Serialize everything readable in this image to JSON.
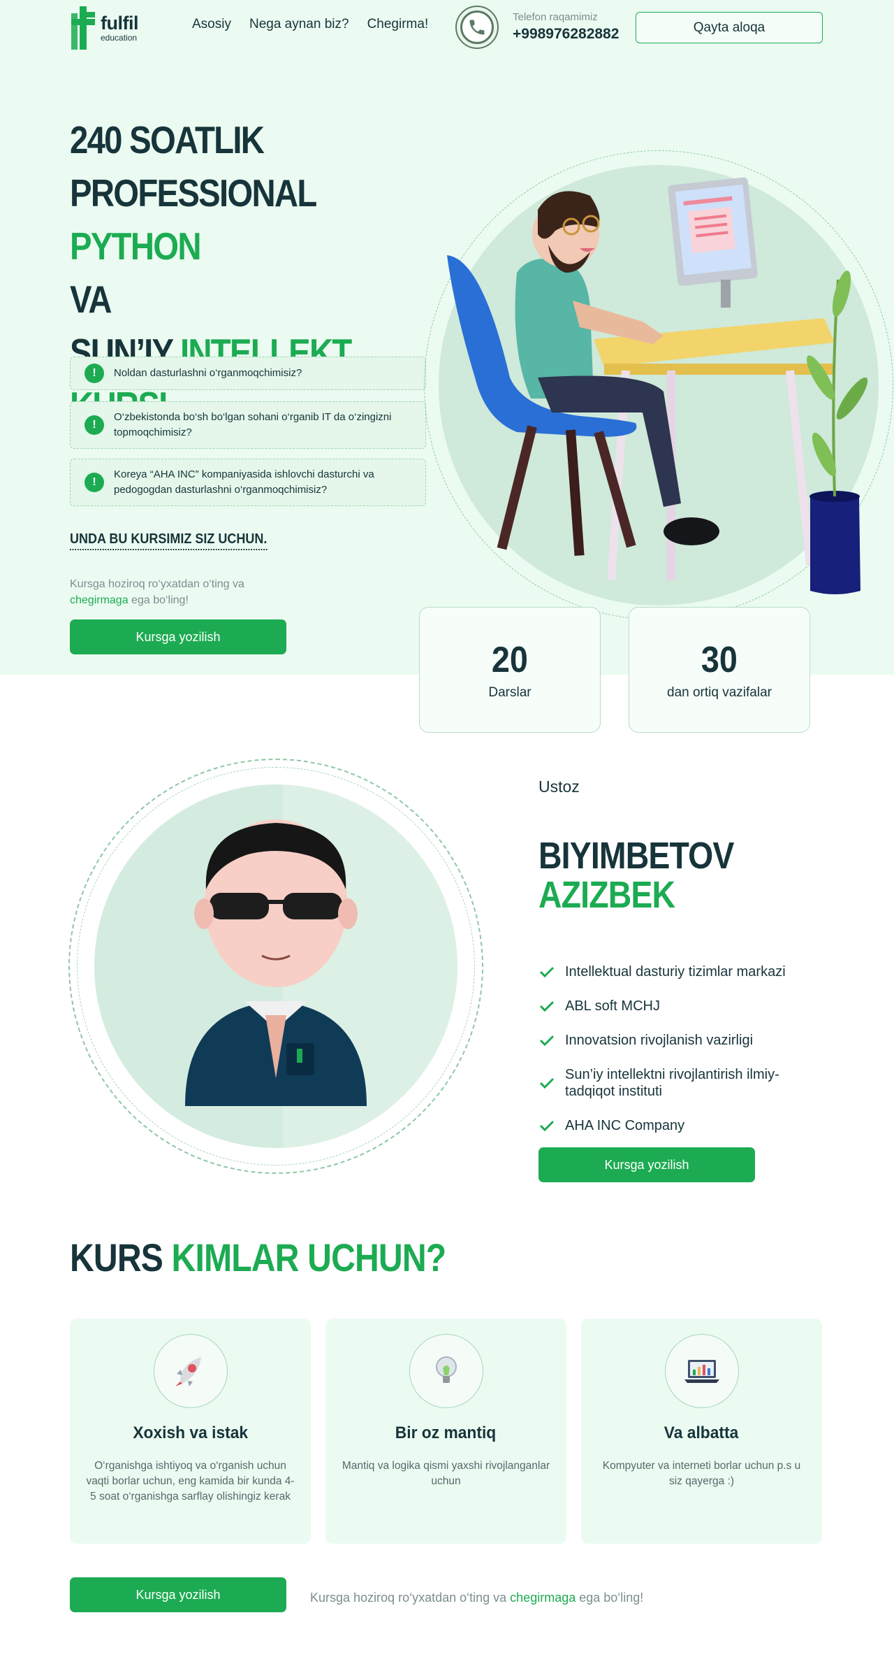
{
  "header": {
    "logo": {
      "name": "fulfil",
      "sub": "education"
    },
    "nav": [
      "Asosiy",
      "Nega aynan biz?",
      "Chegirma!"
    ],
    "phone_label": "Telefon raqamimiz",
    "phone_number": "+998976282882",
    "callback_label": "Qayta aloqa"
  },
  "hero": {
    "title_l1": "240 SOATLIK",
    "title_l2a": "PROFESSIONAL ",
    "title_l2b": "PYTHON",
    "title_l3": "VA",
    "title_l4a": "SUN’IY ",
    "title_l4b": "INTELLEKT KURSI",
    "questions": [
      "Noldan dasturlashni o‘rganmoqchimisiz?",
      "O‘zbekistonda bo‘sh bo‘lgan sohani o‘rganib IT da o‘zingizni topmoqchimisiz?",
      "Koreya “AHA INC” kompaniyasida ishlovchi dasturchi va pedogogdan dasturlashni o‘rganmoqchimisiz?"
    ],
    "question_icon": "!",
    "for_you": "UNDA BU KURSIMIZ SIZ UCHUN.",
    "hint_l1": "Kursga hoziroq ro‘yxatdan o‘ting va",
    "hint_link": "chegirmaga",
    "hint_rest": " ega bo‘ling!",
    "cta": "Kursga yozilish"
  },
  "stats": [
    {
      "value": "20",
      "label": "Darslar"
    },
    {
      "value": "30",
      "label": "dan ortiq vazifalar"
    }
  ],
  "mentor": {
    "role": "Ustoz",
    "first_name": "BIYIMBETOV",
    "last_name": "AZIZBEK",
    "credentials": [
      "Intellektual dasturiy tizimlar markazi",
      "ABL soft MCHJ",
      "Innovatsion rivojlanish vazirligi",
      "Sun’iy intellektni rivojlantirish ilmiy-tadqiqot instituti",
      "AHA INC Company"
    ],
    "cta": "Kursga yozilish"
  },
  "who": {
    "title_a": "KURS ",
    "title_b": "KIMLAR UCHUN?",
    "cards": [
      {
        "icon": "rocket-icon",
        "title": "Xoxish va istak",
        "text": "O‘rganishga ishtiyoq va o‘rganish uchun vaqti borlar uchun, eng kamida bir kunda 4-5 soat o‘rganishga sarflay olishingiz kerak"
      },
      {
        "icon": "lightbulb-icon",
        "title": "Bir oz mantiq",
        "text": "Mantiq va logika qismi yaxshi rivojlanganlar uchun"
      },
      {
        "icon": "laptop-icon",
        "title": "Va albatta",
        "text": "Kompyuter va interneti borlar uchun p.s u siz qayerga :)"
      }
    ],
    "cta": "Kursga yozilish",
    "hint_a": "Kursga hoziroq ro‘yxatdan o‘ting va ",
    "hint_link": "chegirmaga",
    "hint_b": " ega bo‘ling!"
  },
  "colors": {
    "accent": "#1cab52",
    "dark": "#17343a",
    "hero_bg": "#ebfbf1"
  }
}
